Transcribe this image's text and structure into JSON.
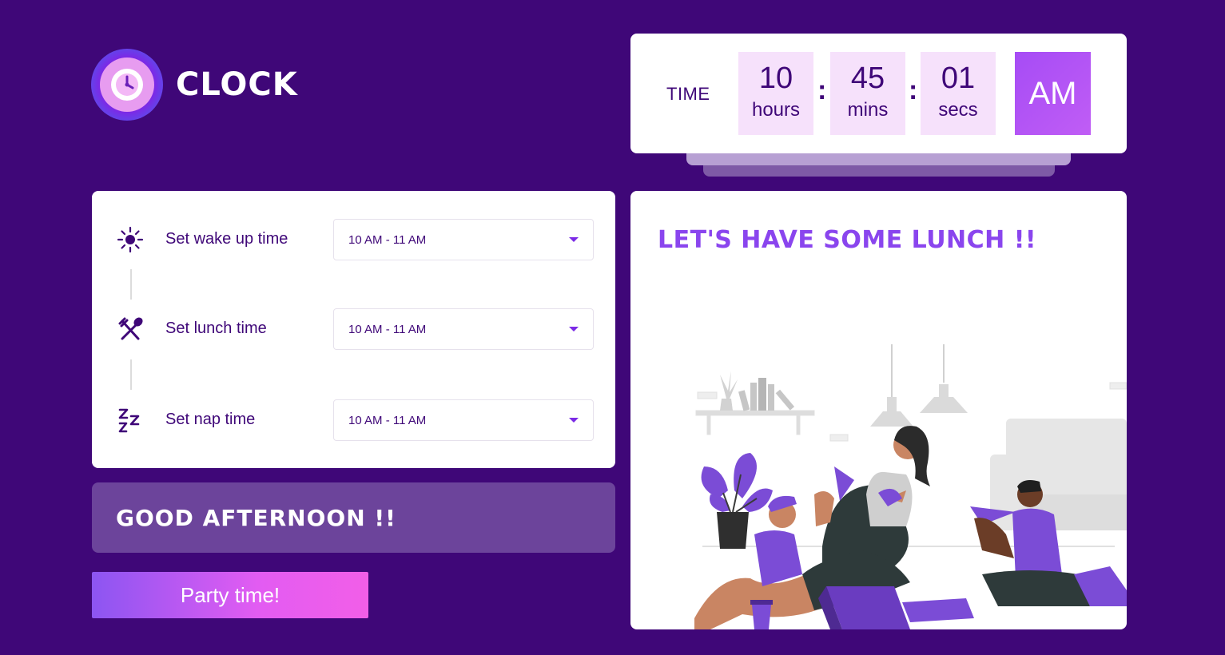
{
  "app": {
    "title": "CLOCK",
    "logo_icon": "clock-icon",
    "colors": {
      "background": "#3f0778",
      "accent": "#8a45ee",
      "time_box": "#f6e1fb",
      "greeting_bg": "#6c449b"
    }
  },
  "time": {
    "label": "TIME",
    "hours": "10",
    "hours_unit": "hours",
    "minutes": "45",
    "minutes_unit": "mins",
    "seconds": "01",
    "seconds_unit": "secs",
    "separator": ":",
    "period": "AM"
  },
  "settings": {
    "wake": {
      "icon": "sun-icon",
      "label": "Set wake up time",
      "value": "10 AM - 11 AM"
    },
    "lunch": {
      "icon": "fork-spoon-icon",
      "label": "Set lunch time",
      "value": "10 AM - 11 AM"
    },
    "nap": {
      "icon": "sleep-zzz-icon",
      "label": "Set nap time",
      "value": "10 AM - 11 AM"
    }
  },
  "greeting": {
    "text": "GOOD AFTERNOON !!"
  },
  "party_button": {
    "label": "Party time!"
  },
  "message": {
    "text": "LET'S HAVE SOME LUNCH !!",
    "illustration": "friends-eating-pizza-illustration"
  }
}
